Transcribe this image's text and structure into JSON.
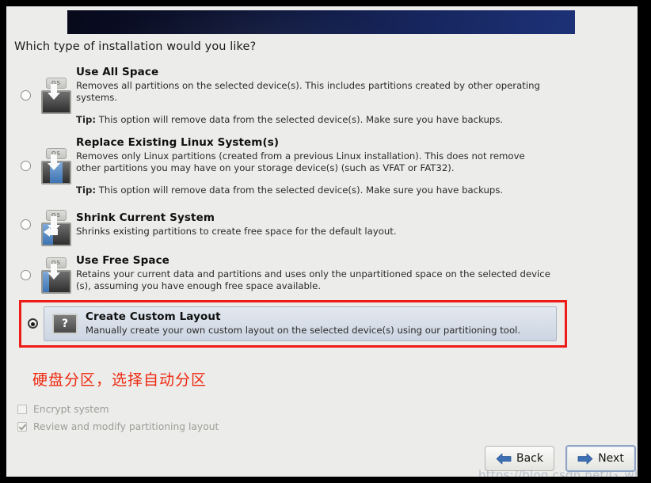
{
  "window": {
    "prompt": "Which type of installation would you like?"
  },
  "banner": {
    "gradient_start": "#07091a",
    "gradient_end": "#1d3177"
  },
  "options": [
    {
      "id": "use-all-space",
      "title": "Use All Space",
      "description": "Removes all partitions on the selected device(s).  This includes partitions created by other operating systems.",
      "tip_label": "Tip:",
      "tip_text": " This option will remove data from the selected device(s).  Make sure you have backups.",
      "selected": false,
      "icon": "disk-install-icon"
    },
    {
      "id": "replace-existing-linux",
      "title": "Replace Existing Linux System(s)",
      "description": "Removes only Linux partitions (created from a previous Linux installation).  This does not remove other partitions you may have on your storage device(s) (such as VFAT or FAT32).",
      "tip_label": "Tip:",
      "tip_text": " This option will remove data from the selected device(s).  Make sure you have backups.",
      "selected": false,
      "icon": "disk-replace-icon"
    },
    {
      "id": "shrink-current-system",
      "title": "Shrink Current System",
      "description": "Shrinks existing partitions to create free space for the default layout.",
      "tip_label": "",
      "tip_text": "",
      "selected": false,
      "icon": "disk-shrink-icon"
    },
    {
      "id": "use-free-space",
      "title": "Use Free Space",
      "description": "Retains your current data and partitions and uses only the unpartitioned space on the selected device (s), assuming you have enough free space available.",
      "tip_label": "",
      "tip_text": "",
      "selected": false,
      "icon": "disk-freespace-icon"
    },
    {
      "id": "create-custom-layout",
      "title": "Create Custom Layout",
      "description": "Manually create your own custom layout on the selected device(s) using our partitioning tool.",
      "tip_label": "",
      "tip_text": "",
      "selected": true,
      "icon": "question-mark-icon"
    }
  ],
  "annotation": {
    "text": "硬盘分区，选择自动分区",
    "color": "#ee2a11"
  },
  "checkboxes": [
    {
      "id": "encrypt-system",
      "label": "Encrypt system",
      "checked": false,
      "disabled": true
    },
    {
      "id": "review-modify-partitioning",
      "label": "Review and modify partitioning layout",
      "checked": true,
      "disabled": true
    }
  ],
  "buttons": {
    "back": {
      "label": "Back",
      "icon": "arrow-left-icon"
    },
    "next": {
      "label": "Next",
      "icon": "arrow-right-icon"
    }
  },
  "watermark": {
    "text": "https://blog.csdn.net/G_whang"
  },
  "highlight": {
    "border_color": "#ee1c16"
  }
}
